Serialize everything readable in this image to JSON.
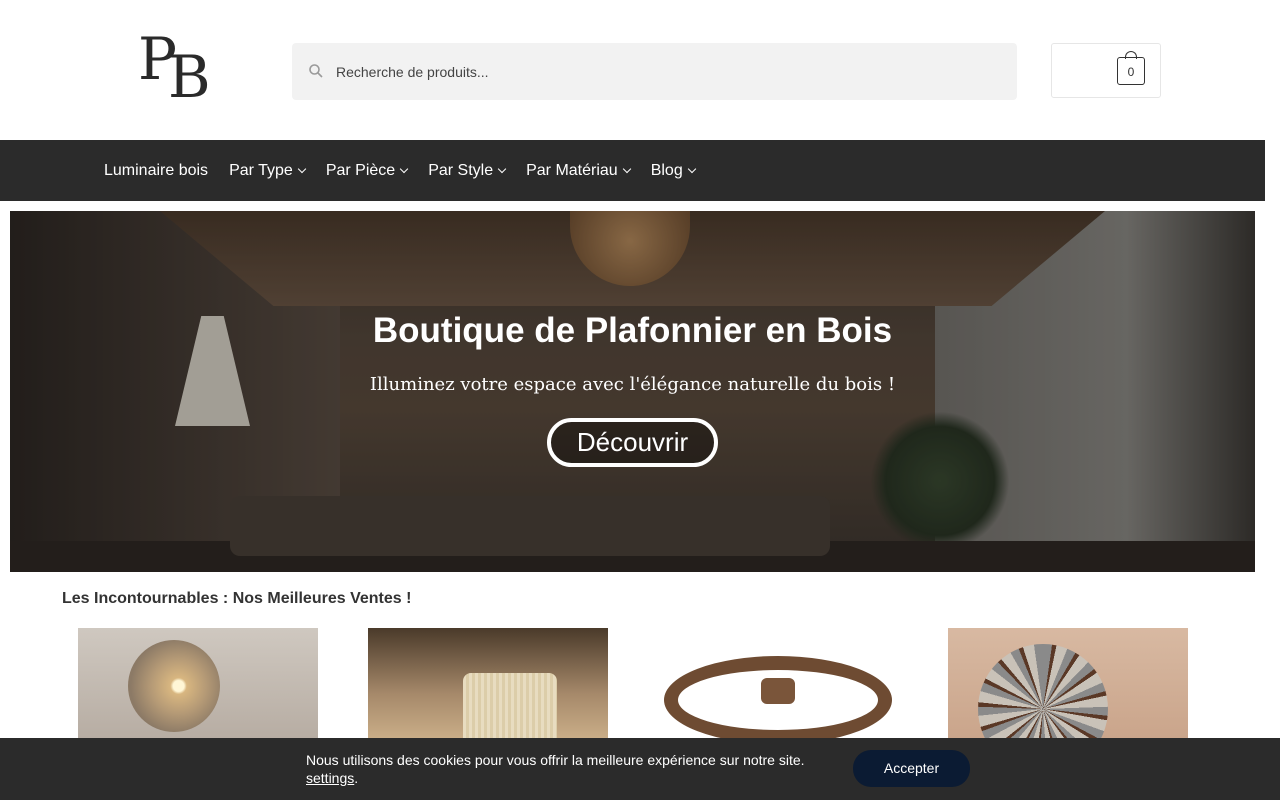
{
  "header": {
    "logo_text_p": "P",
    "logo_text_b": "B",
    "search_placeholder": "Recherche de produits...",
    "cart_count": "0"
  },
  "nav": {
    "items": [
      {
        "label": "Luminaire bois",
        "has_dropdown": false
      },
      {
        "label": "Par Type",
        "has_dropdown": true
      },
      {
        "label": "Par Pièce",
        "has_dropdown": true
      },
      {
        "label": "Par Style",
        "has_dropdown": true
      },
      {
        "label": "Par Matériau",
        "has_dropdown": true
      },
      {
        "label": "Blog",
        "has_dropdown": true
      }
    ]
  },
  "hero": {
    "title": "Boutique de Plafonnier en Bois",
    "subtitle": "Illuminez votre espace avec l'élégance naturelle du bois !",
    "button_label": "Découvrir"
  },
  "bestsellers": {
    "title": "Les Incontournables : Nos Meilleures Ventes !"
  },
  "cookie": {
    "message": "Nous utilisons des cookies pour vous offrir la meilleure expérience sur notre site.",
    "settings_link": "settings",
    "settings_suffix": ".",
    "accept_label": "Accepter"
  },
  "colors": {
    "nav_bg": "#2b2b2b",
    "cookie_bg": "#2b2b2b",
    "accept_bg": "#0b1b33",
    "search_bg": "#f2f2f2"
  },
  "icons": {
    "search": "search-icon",
    "cart": "shopping-bag-icon",
    "dropdown": "chevron-down-icon"
  }
}
